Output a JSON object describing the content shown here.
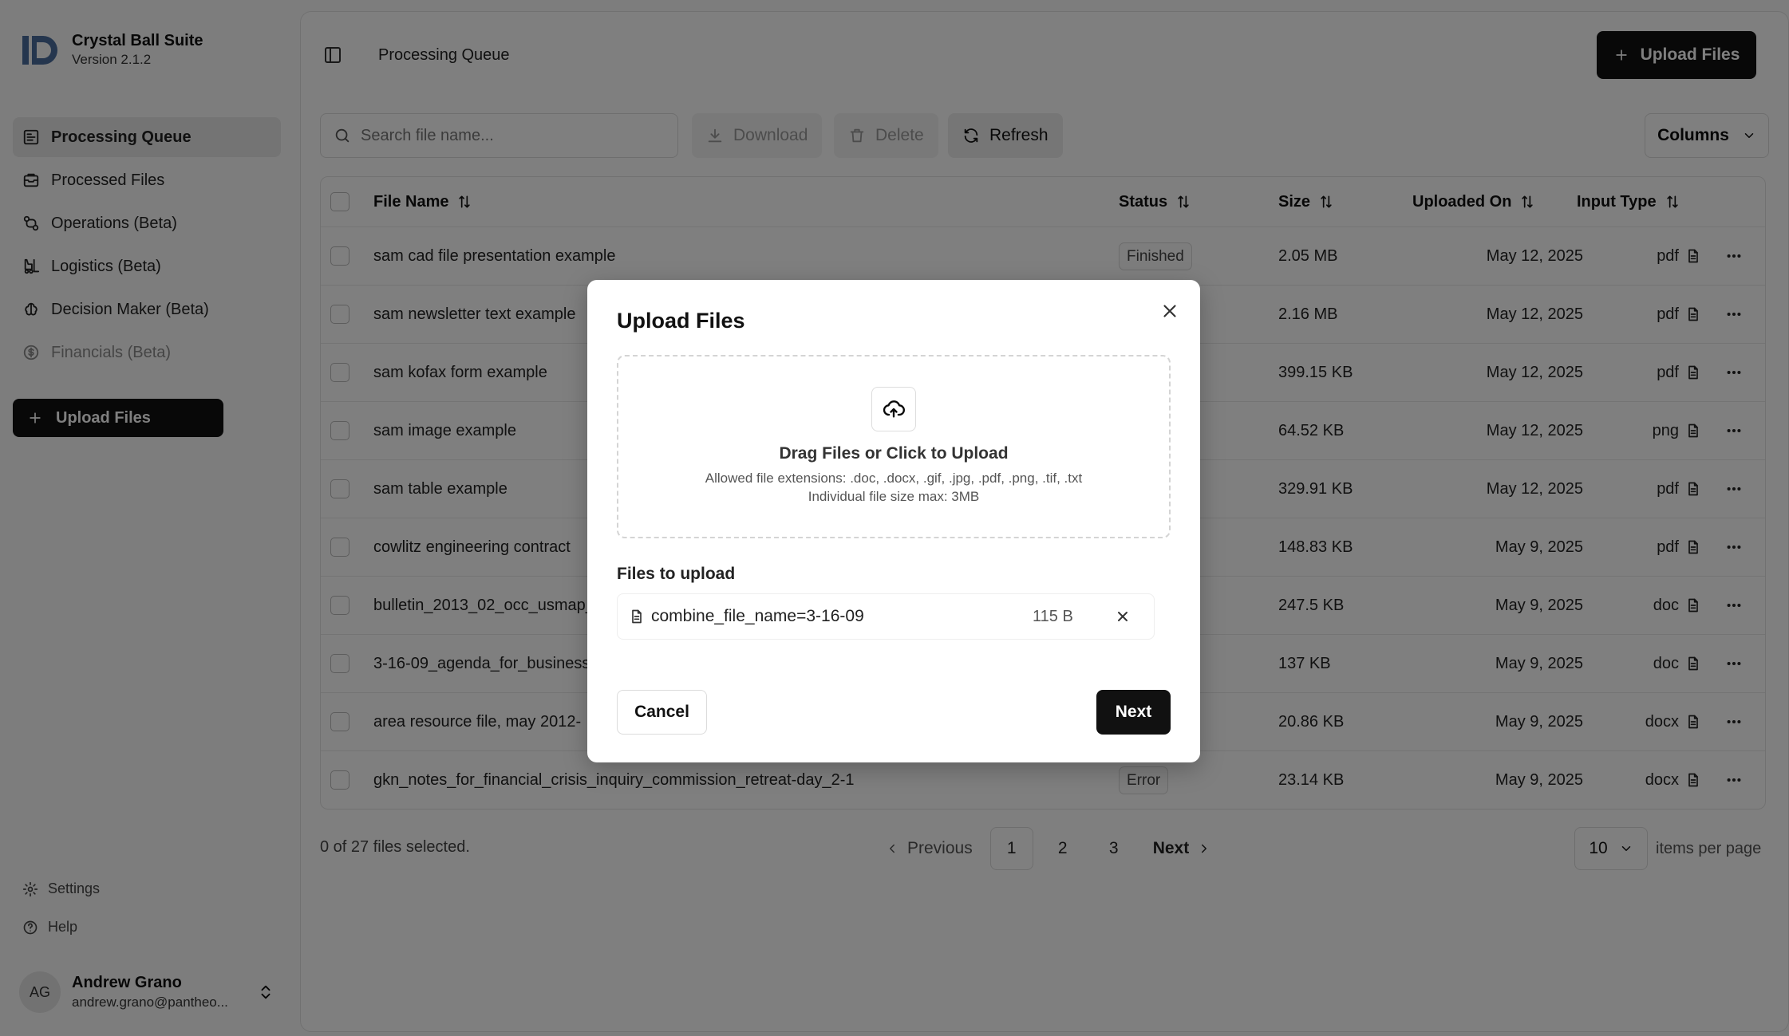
{
  "brand": {
    "name": "Crystal Ball Suite",
    "version": "Version 2.1.2"
  },
  "sidebar": {
    "items": [
      {
        "label": "Processing Queue",
        "icon": "queue-icon",
        "active": true
      },
      {
        "label": "Processed Files",
        "icon": "inbox-icon"
      },
      {
        "label": "Operations (Beta)",
        "icon": "workflow-icon"
      },
      {
        "label": "Logistics (Beta)",
        "icon": "forklift-icon"
      },
      {
        "label": "Decision Maker (Beta)",
        "icon": "brain-icon"
      },
      {
        "label": "Financials (Beta)",
        "icon": "dollar-icon",
        "disabled": true
      }
    ],
    "upload_label": "Upload Files",
    "settings_label": "Settings",
    "help_label": "Help",
    "user": {
      "initials": "AG",
      "name": "Andrew Grano",
      "email": "andrew.grano@pantheo..."
    }
  },
  "header": {
    "title": "Processing Queue",
    "upload_label": "Upload Files"
  },
  "toolbar": {
    "search_placeholder": "Search file name...",
    "download_label": "Download",
    "delete_label": "Delete",
    "refresh_label": "Refresh",
    "columns_label": "Columns"
  },
  "table": {
    "columns": {
      "name": "File Name",
      "status": "Status",
      "size": "Size",
      "uploaded": "Uploaded On",
      "type": "Input Type"
    },
    "rows": [
      {
        "name": "sam cad file presentation example",
        "status": "Finished",
        "size": "2.05 MB",
        "date": "May 12, 2025",
        "type": "pdf"
      },
      {
        "name": "sam newsletter text example",
        "status": "",
        "size": "2.16 MB",
        "date": "May 12, 2025",
        "type": "pdf"
      },
      {
        "name": "sam kofax form example",
        "status": "",
        "size": "399.15 KB",
        "date": "May 12, 2025",
        "type": "pdf"
      },
      {
        "name": "sam image example",
        "status": "",
        "size": "64.52 KB",
        "date": "May 12, 2025",
        "type": "png"
      },
      {
        "name": "sam table example",
        "status": "",
        "size": "329.91 KB",
        "date": "May 12, 2025",
        "type": "pdf"
      },
      {
        "name": "cowlitz engineering contract",
        "status": "",
        "size": "148.83 KB",
        "date": "May 9, 2025",
        "type": "pdf"
      },
      {
        "name": "bulletin_2013_02_occ_usmap_",
        "status": "",
        "size": "247.5 KB",
        "date": "May 9, 2025",
        "type": "doc"
      },
      {
        "name": "3-16-09_agenda_for_business",
        "status": "",
        "size": "137 KB",
        "date": "May 9, 2025",
        "type": "doc"
      },
      {
        "name": "area resource file, may 2012-",
        "status": "",
        "size": "20.86 KB",
        "date": "May 9, 2025",
        "type": "docx"
      },
      {
        "name": "gkn_notes_for_financial_crisis_inquiry_commission_retreat-day_2-1",
        "status": "Error",
        "size": "23.14 KB",
        "date": "May 9, 2025",
        "type": "docx"
      }
    ]
  },
  "footer": {
    "selected_text": "0 of 27 files selected.",
    "prev_label": "Previous",
    "pages": [
      "1",
      "2",
      "3"
    ],
    "current_page": "1",
    "next_label": "Next",
    "per_page_value": "10",
    "per_page_label": "items per page"
  },
  "modal": {
    "title": "Upload Files",
    "drop_title": "Drag Files or Click to Upload",
    "allowed_text": "Allowed file extensions: .doc, .docx, .gif, .jpg, .pdf, .png, .tif, .txt",
    "max_size_text": "Individual file size max: 3MB",
    "files_label": "Files to upload",
    "file": {
      "name": "combine_file_name=3-16-09",
      "size": "115 B"
    },
    "cancel_label": "Cancel",
    "next_label": "Next"
  }
}
